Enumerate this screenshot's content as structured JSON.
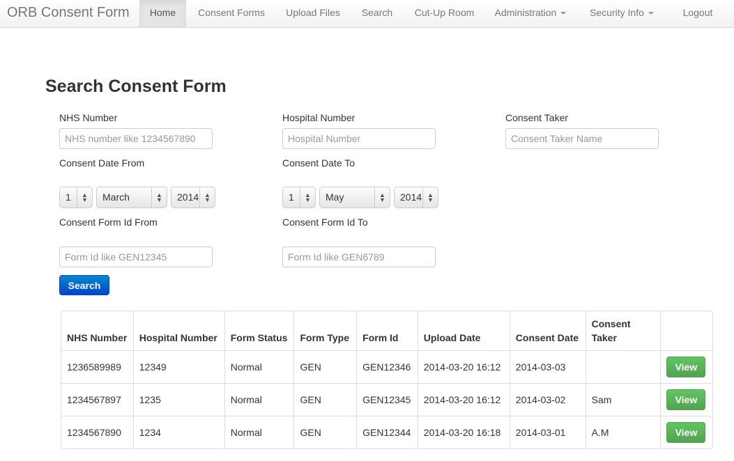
{
  "nav": {
    "brand": "ORB Consent Form",
    "items": [
      "Home",
      "Consent Forms",
      "Upload Files",
      "Search",
      "Cut-Up Room",
      "Administration",
      "Security Info",
      "Logout"
    ]
  },
  "title": "Search Consent Form",
  "form": {
    "nhs_label": "NHS Number",
    "nhs_placeholder": "NHS number like 1234567890",
    "hosp_label": "Hospital Number",
    "hosp_placeholder": "Hospital Number",
    "taker_label": "Consent Taker",
    "taker_placeholder": "Consent Taker Name",
    "date_from_label": "Consent Date From",
    "date_from": {
      "day": "1",
      "month": "March",
      "year": "2014"
    },
    "date_to_label": "Consent Date To",
    "date_to": {
      "day": "1",
      "month": "May",
      "year": "2014"
    },
    "id_from_label": "Consent Form Id From",
    "id_from_placeholder": "Form Id like GEN12345",
    "id_to_label": "Consent Form Id To",
    "id_to_placeholder": "Form Id like GEN6789",
    "search_label": "Search"
  },
  "table": {
    "headers": [
      "NHS Number",
      "Hospital Number",
      "Form Status",
      "Form Type",
      "Form Id",
      "Upload Date",
      "Consent Date",
      "Consent Taker",
      ""
    ],
    "rows": [
      [
        "1236589989",
        "12349",
        "Normal",
        "GEN",
        "GEN12346",
        "2014-03-20 16:12",
        "2014-03-03",
        ""
      ],
      [
        "1234567897",
        "1235",
        "Normal",
        "GEN",
        "GEN12345",
        "2014-03-20 16:12",
        "2014-03-02",
        "Sam"
      ],
      [
        "1234567890",
        "1234",
        "Normal",
        "GEN",
        "GEN12344",
        "2014-03-20 16:18",
        "2014-03-01",
        "A.M"
      ]
    ],
    "view_label": "View"
  }
}
